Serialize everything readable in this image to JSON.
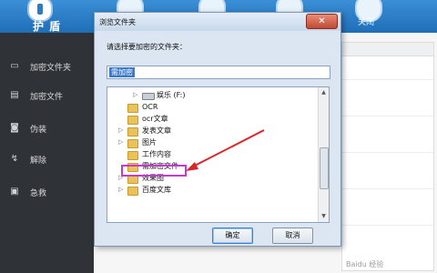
{
  "app": {
    "logo_text": "护 盾",
    "toolbar_close_label": "关闭"
  },
  "sidebar": {
    "items": [
      {
        "label": "加密文件夹",
        "icon": "folder-icon"
      },
      {
        "label": "加密文件",
        "icon": "file-icon"
      },
      {
        "label": "伪装",
        "icon": "mask-icon"
      },
      {
        "label": "解除",
        "icon": "unlock-icon"
      },
      {
        "label": "急救",
        "icon": "first-aid-icon"
      }
    ]
  },
  "dialog": {
    "title": "浏览文件夹",
    "close_label": "✕",
    "prompt": "请选择要加密的文件夹：",
    "path_value": "需加密",
    "tree": [
      {
        "label": "娱乐 (F:)",
        "type": "drive",
        "expandable": true
      },
      {
        "label": "OCR",
        "type": "folder",
        "expandable": false
      },
      {
        "label": "ocr文章",
        "type": "folder",
        "expandable": false
      },
      {
        "label": "发表文章",
        "type": "folder",
        "expandable": true
      },
      {
        "label": "图片",
        "type": "folder",
        "expandable": true
      },
      {
        "label": "工作内容",
        "type": "folder",
        "expandable": false
      },
      {
        "label": "需加密文件",
        "type": "folder",
        "expandable": false,
        "highlighted": true
      },
      {
        "label": "效果图",
        "type": "folder",
        "expandable": true
      },
      {
        "label": "百度文库",
        "type": "folder",
        "expandable": true
      }
    ],
    "ok_label": "确定",
    "cancel_label": "取消"
  },
  "watermark": "Baidu 经验",
  "colors": {
    "topbar": "#2b7cc4",
    "sidebar": "#2f3338",
    "highlight_box": "#c43ad0",
    "annotation_arrow": "#d9262b"
  }
}
